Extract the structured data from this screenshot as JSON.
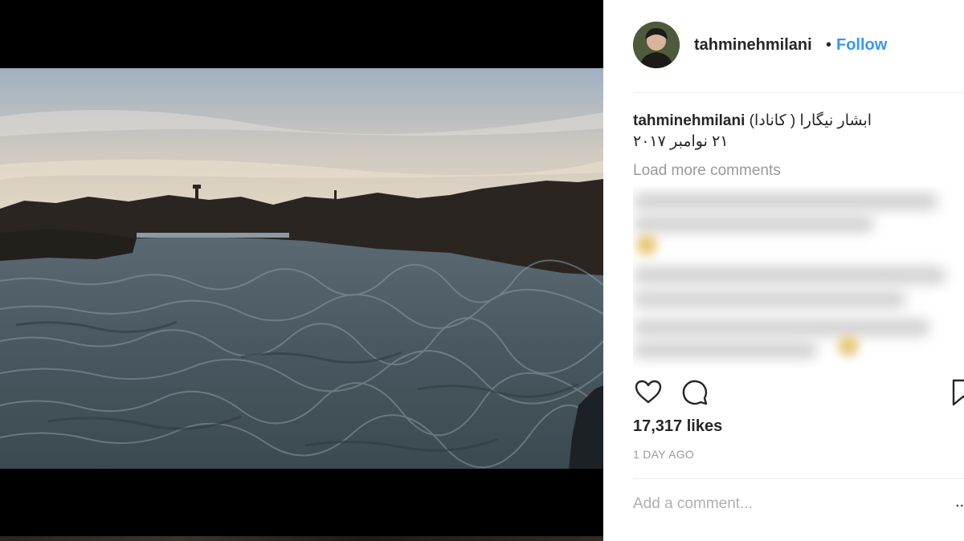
{
  "post": {
    "username": "tahminehmilani",
    "separator": "•",
    "follow_label": "Follow",
    "caption_user": "tahminehmilani",
    "caption_line1": "ابشار نیگارا ( کانادا)",
    "caption_line2": "۲۱ نوامبر ۲۰۱۷",
    "load_more_label": "Load more comments",
    "likes_text": "17,317 likes",
    "time_ago": "1 DAY AGO",
    "comment_placeholder": "Add a comment...",
    "more_label": "..."
  },
  "icons": {
    "like": "heart-outline-icon",
    "comment": "speech-bubble-icon",
    "save": "bookmark-icon",
    "more": "more-dots-icon"
  },
  "colors": {
    "follow_blue": "#3897f0",
    "text_dark": "#262626",
    "text_muted": "#999999"
  }
}
